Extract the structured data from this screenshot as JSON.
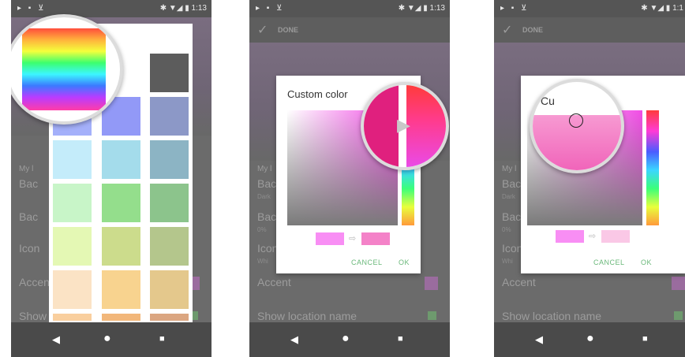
{
  "status": {
    "left_icons": "▸ ▪ ⊻",
    "right_text": "✱ ▼◢ ▮ 1:13",
    "right_text_cut": "✱ ▼◢ ▮ 1:1"
  },
  "toolbar": {
    "done_label": "DONE"
  },
  "settings": {
    "row1": "My l",
    "row2": "Bac",
    "row2_sub": "Dark",
    "row3": "Bac",
    "row3_sub": "0%",
    "row4": "Icon",
    "row4_sub": "Whi",
    "accent": "Accent",
    "show_location": "Show location name"
  },
  "dialog": {
    "title": "Custom color",
    "title_zoom": "Cu",
    "title_zoom_big": "",
    "cancel": "CANCEL",
    "ok": "OK"
  },
  "colors": {
    "accent_swatch": "#9a6c9e",
    "old_color": "#f88ef4",
    "new_color_2": "#f482c8",
    "new_color_3": "#fac8e6",
    "button_green": "#6ab87a"
  },
  "swatches": [
    [
      "#ffffff",
      "#ffffff",
      "#5c5c5c"
    ],
    [
      "#a4b0fa",
      "#9299f7",
      "#8c98c7"
    ],
    [
      "#c4ecfa",
      "#a4dceb",
      "#8cb4c4"
    ],
    [
      "#c8f5c8",
      "#94de8c",
      "#8cc48c"
    ],
    [
      "#e4f8b4",
      "#ccdc8c",
      "#b4c68c"
    ],
    [
      "#fbe3c5",
      "#f8d38f",
      "#e4c88c"
    ]
  ],
  "icons": [
    "check-icon",
    "back-icon",
    "home-icon",
    "recents-icon",
    "arrow-right-icon",
    "bluetooth-icon",
    "wifi-icon",
    "battery-icon"
  ]
}
